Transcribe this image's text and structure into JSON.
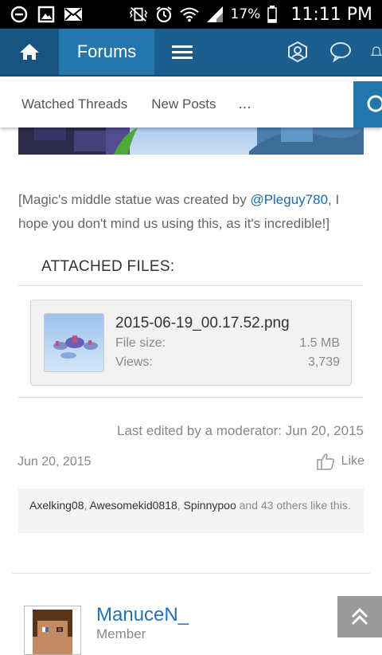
{
  "status_bar": {
    "battery": "17%",
    "time": "11:11 PM",
    "icons": [
      "minus-circle-icon",
      "image-icon",
      "mail-icon",
      "vibrate-icon",
      "alarm-icon",
      "wifi-icon",
      "signal-icon",
      "battery-icon"
    ]
  },
  "nav": {
    "home_icon": "home-icon",
    "title": "Forums",
    "menu_icon": "menu-icon",
    "right_icons": [
      "account-icon",
      "chat-icon",
      "bell-icon"
    ],
    "bar_color": "#1c5f8e"
  },
  "tabs": {
    "items": [
      "Watched Threads",
      "New Posts"
    ],
    "more": "...",
    "search_icon": "search-icon"
  },
  "post": {
    "caption_before": "[Magic's middle statue was created by ",
    "mention": "@Pleguy780",
    "caption_after": ", I hope you don't mind us using this, as it's incredible!]",
    "attached_title": "ATTACHED FILES:",
    "file": {
      "name": "2015-06-19_00.17.52.png",
      "size_label": "File size:",
      "size_value": "1.5 MB",
      "views_label": "Views:",
      "views_value": "3,739"
    },
    "last_edited": "Last edited by a moderator: Jun 20, 2015",
    "date": "Jun 20, 2015",
    "like_label": "Like",
    "likes": {
      "user1": "Axelking08",
      "user2": "Awesomekid0818",
      "user3": "Spinnypoo",
      "sep": ", ",
      "rest": " and 43 others like this."
    }
  },
  "next_post": {
    "username": "ManuceN_",
    "role": "Member"
  },
  "scroll_top_icon": "double-chevron-up-icon"
}
